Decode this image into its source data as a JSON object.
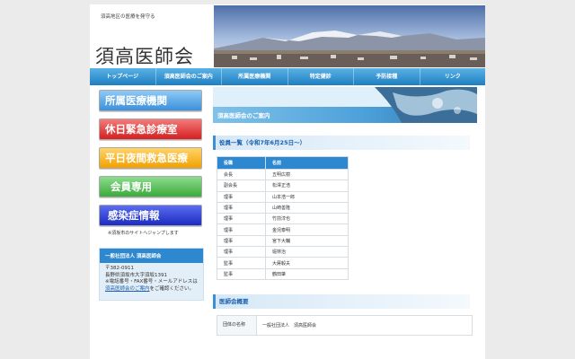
{
  "header": {
    "tagline": "須高地区の医療を発守る",
    "logo": "須高医師会"
  },
  "nav": {
    "items": [
      {
        "label": "トップページ"
      },
      {
        "label": "須高医師会のご案内"
      },
      {
        "label": "所属医療機関"
      },
      {
        "label": "特定健診"
      },
      {
        "label": "予防接種"
      },
      {
        "label": "リンク"
      }
    ]
  },
  "sidebar": {
    "buttons": [
      {
        "label": "所属医療機関"
      },
      {
        "label": "休日緊急診療室"
      },
      {
        "label": "平日夜間救急医療"
      },
      {
        "label": "会員専用"
      },
      {
        "label": "感染症情報"
      }
    ],
    "note": "※須坂市のサイトへジャンプします",
    "association": {
      "title": "一般社団法人 須高医師会",
      "postal": "〒382-0911",
      "address": "長野県須坂市大字須坂1391",
      "contact_prefix": "※電話番号・FAX番号・メールアドレスは",
      "contact_link": "須高医師会のご案内",
      "contact_suffix": "をご確認ください。"
    }
  },
  "main": {
    "banner_title": "須高医師会のご案内",
    "officers_heading": "役員一覧（令和7年6月25日〜）",
    "officers_columns": [
      "役職",
      "名前"
    ],
    "officers": [
      {
        "role": "会長",
        "name": "五明広樹"
      },
      {
        "role": "副会長",
        "name": "松澤正浩"
      },
      {
        "role": "理事",
        "name": "山本浩一郎"
      },
      {
        "role": "理事",
        "name": "山崎善隆"
      },
      {
        "role": "理事",
        "name": "竹前淳也"
      },
      {
        "role": "理事",
        "name": "金児泰明"
      },
      {
        "role": "理事",
        "name": "宮下大輔"
      },
      {
        "role": "理事",
        "name": "堀林治"
      },
      {
        "role": "監事",
        "name": "大蔣毅夫"
      },
      {
        "role": "監事",
        "name": "鶴田肇"
      }
    ],
    "overview_heading": "医師会概要",
    "overview_rows": [
      {
        "key": "団体の名称",
        "value": "一般社団法人　須高医師会"
      }
    ]
  },
  "colors": {
    "accent": "#2d88cf",
    "nav": "#1f7fc2",
    "page_background": "#ebebeb"
  }
}
